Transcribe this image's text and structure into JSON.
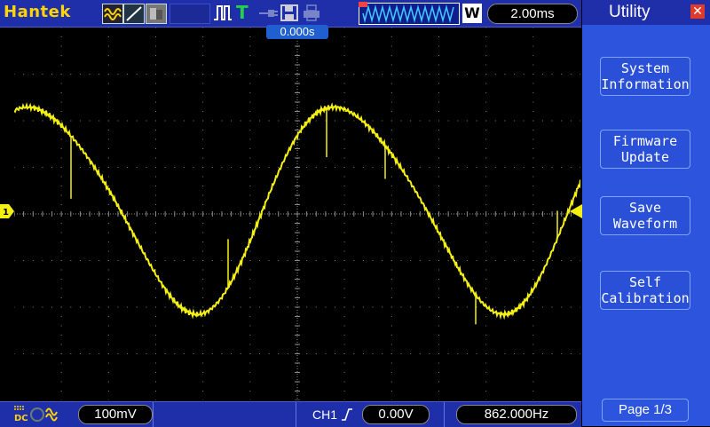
{
  "header": {
    "brand": "Hantek",
    "timebase": "2.00ms",
    "acq_mode": "W"
  },
  "display": {
    "trigger_position": "0.000s",
    "trace_color": "#f5f013"
  },
  "footer": {
    "coupling": "DC",
    "volts_per_div": "100mV",
    "channel": "CH1",
    "trigger_level": "0.00V",
    "frequency": "862.000Hz"
  },
  "menu": {
    "title": "Utility",
    "buttons": [
      {
        "line1": "System",
        "line2": "Information"
      },
      {
        "line1": "Firmware",
        "line2": "Update"
      },
      {
        "line1": "Save",
        "line2": "Waveform"
      },
      {
        "line1": "Self",
        "line2": "Calibration"
      }
    ],
    "page": "Page 1/3"
  },
  "colors": {
    "bar": "#1f2faa",
    "menu": "#2c54dd",
    "brand": "#ffd400",
    "trace": "#f5f013"
  }
}
